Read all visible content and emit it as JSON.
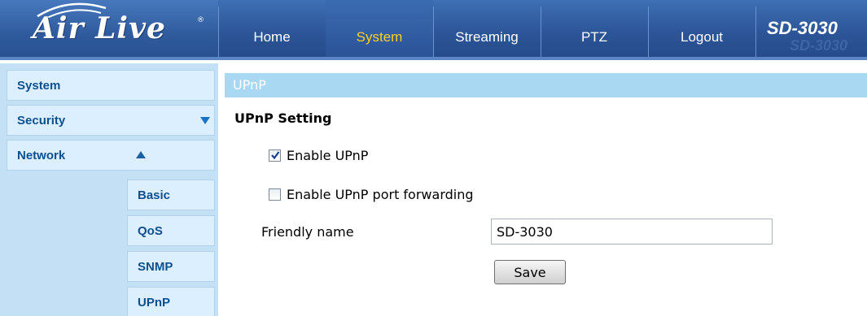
{
  "brand": {
    "logo_text": "Air Live",
    "registered_mark": "®",
    "model": "SD-3030"
  },
  "nav": {
    "tabs": [
      {
        "label": "Home",
        "active": false
      },
      {
        "label": "System",
        "active": true
      },
      {
        "label": "Streaming",
        "active": false
      },
      {
        "label": "PTZ",
        "active": false
      },
      {
        "label": "Logout",
        "active": false
      }
    ]
  },
  "sidebar": {
    "items": [
      {
        "label": "System",
        "icon": null
      },
      {
        "label": "Security",
        "icon": "arrow-down-icon"
      },
      {
        "label": "Network",
        "icon": "arrow-up-icon"
      }
    ],
    "sub_items": [
      {
        "label": "Basic"
      },
      {
        "label": "QoS"
      },
      {
        "label": "SNMP"
      },
      {
        "label": "UPnP"
      }
    ]
  },
  "main": {
    "section_title": "UPnP",
    "heading": "UPnP Setting",
    "enable_upnp": {
      "label": "Enable UPnP",
      "checked": true
    },
    "enable_port_forwarding": {
      "label": "Enable UPnP port forwarding",
      "checked": false
    },
    "friendly_name": {
      "label": "Friendly name",
      "value": "SD-3030"
    },
    "save_label": "Save"
  },
  "colors": {
    "header_blue": "#2c5598",
    "active_tab_text": "#ffd31c",
    "sidebar_bg": "#c3e0f5",
    "sidebar_item_bg": "#dcefff",
    "sidebar_text": "#0d4f8f",
    "section_bar": "#a9d8f2"
  }
}
